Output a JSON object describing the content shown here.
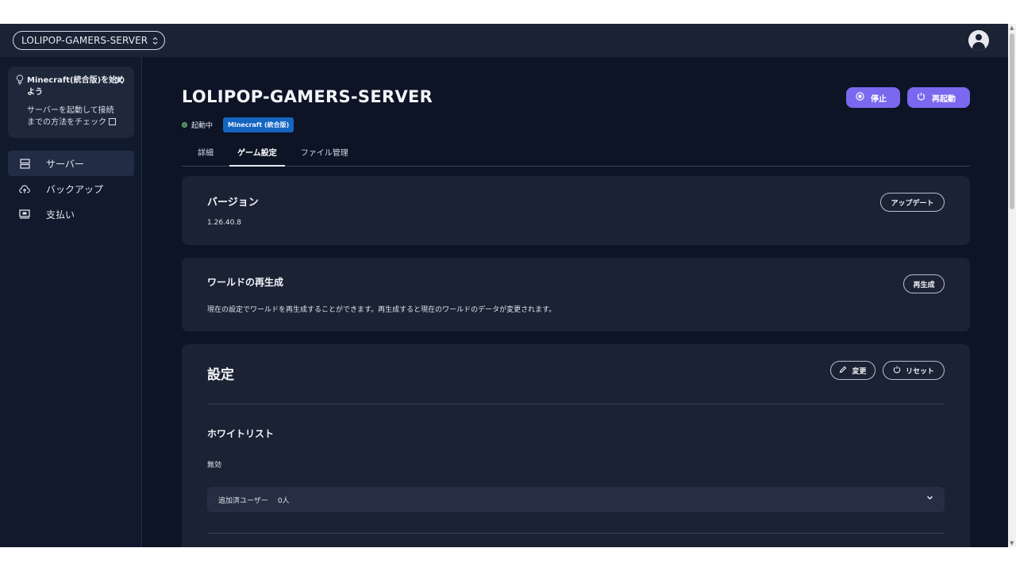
{
  "topbar": {
    "server_selector": "LOLIPOP-GAMERS-SERVER"
  },
  "sidebar": {
    "tip": {
      "title": "Minecraft(統合版)を始めよう",
      "body": "サーバーを起動して接続までの方法をチェック"
    },
    "items": [
      {
        "label": "サーバー",
        "icon": "server-icon",
        "active": true
      },
      {
        "label": "バックアップ",
        "icon": "cloud-upload-icon",
        "active": false
      },
      {
        "label": "支払い",
        "icon": "payment-icon",
        "active": false
      }
    ]
  },
  "main": {
    "title": "LOLIPOP-GAMERS-SERVER",
    "status": "起動中",
    "edition_badge": "Minecraft (統合版)",
    "stop_button": "停止",
    "restart_button": "再起動",
    "tabs": [
      {
        "label": "詳細",
        "active": false
      },
      {
        "label": "ゲーム設定",
        "active": true
      },
      {
        "label": "ファイル管理",
        "active": false
      }
    ],
    "version_card": {
      "heading": "バージョン",
      "value": "1.26.40.8",
      "button": "アップデート"
    },
    "regenerate_card": {
      "heading": "ワールドの再生成",
      "description": "現在の設定でワールドを再生成することができます。再生成すると現在のワールドのデータが変更されます。",
      "button": "再生成"
    },
    "settings_card": {
      "heading": "設定",
      "edit_button": "変更",
      "reset_button": "リセット",
      "whitelist": {
        "heading": "ホワイトリスト",
        "value": "無効",
        "users_label": "追加済ユーザー",
        "users_count": "0人"
      }
    }
  },
  "colors": {
    "background": "#0c1426",
    "card": "#1a2234",
    "accent": "#7b68ee",
    "badge": "#1565c0"
  }
}
